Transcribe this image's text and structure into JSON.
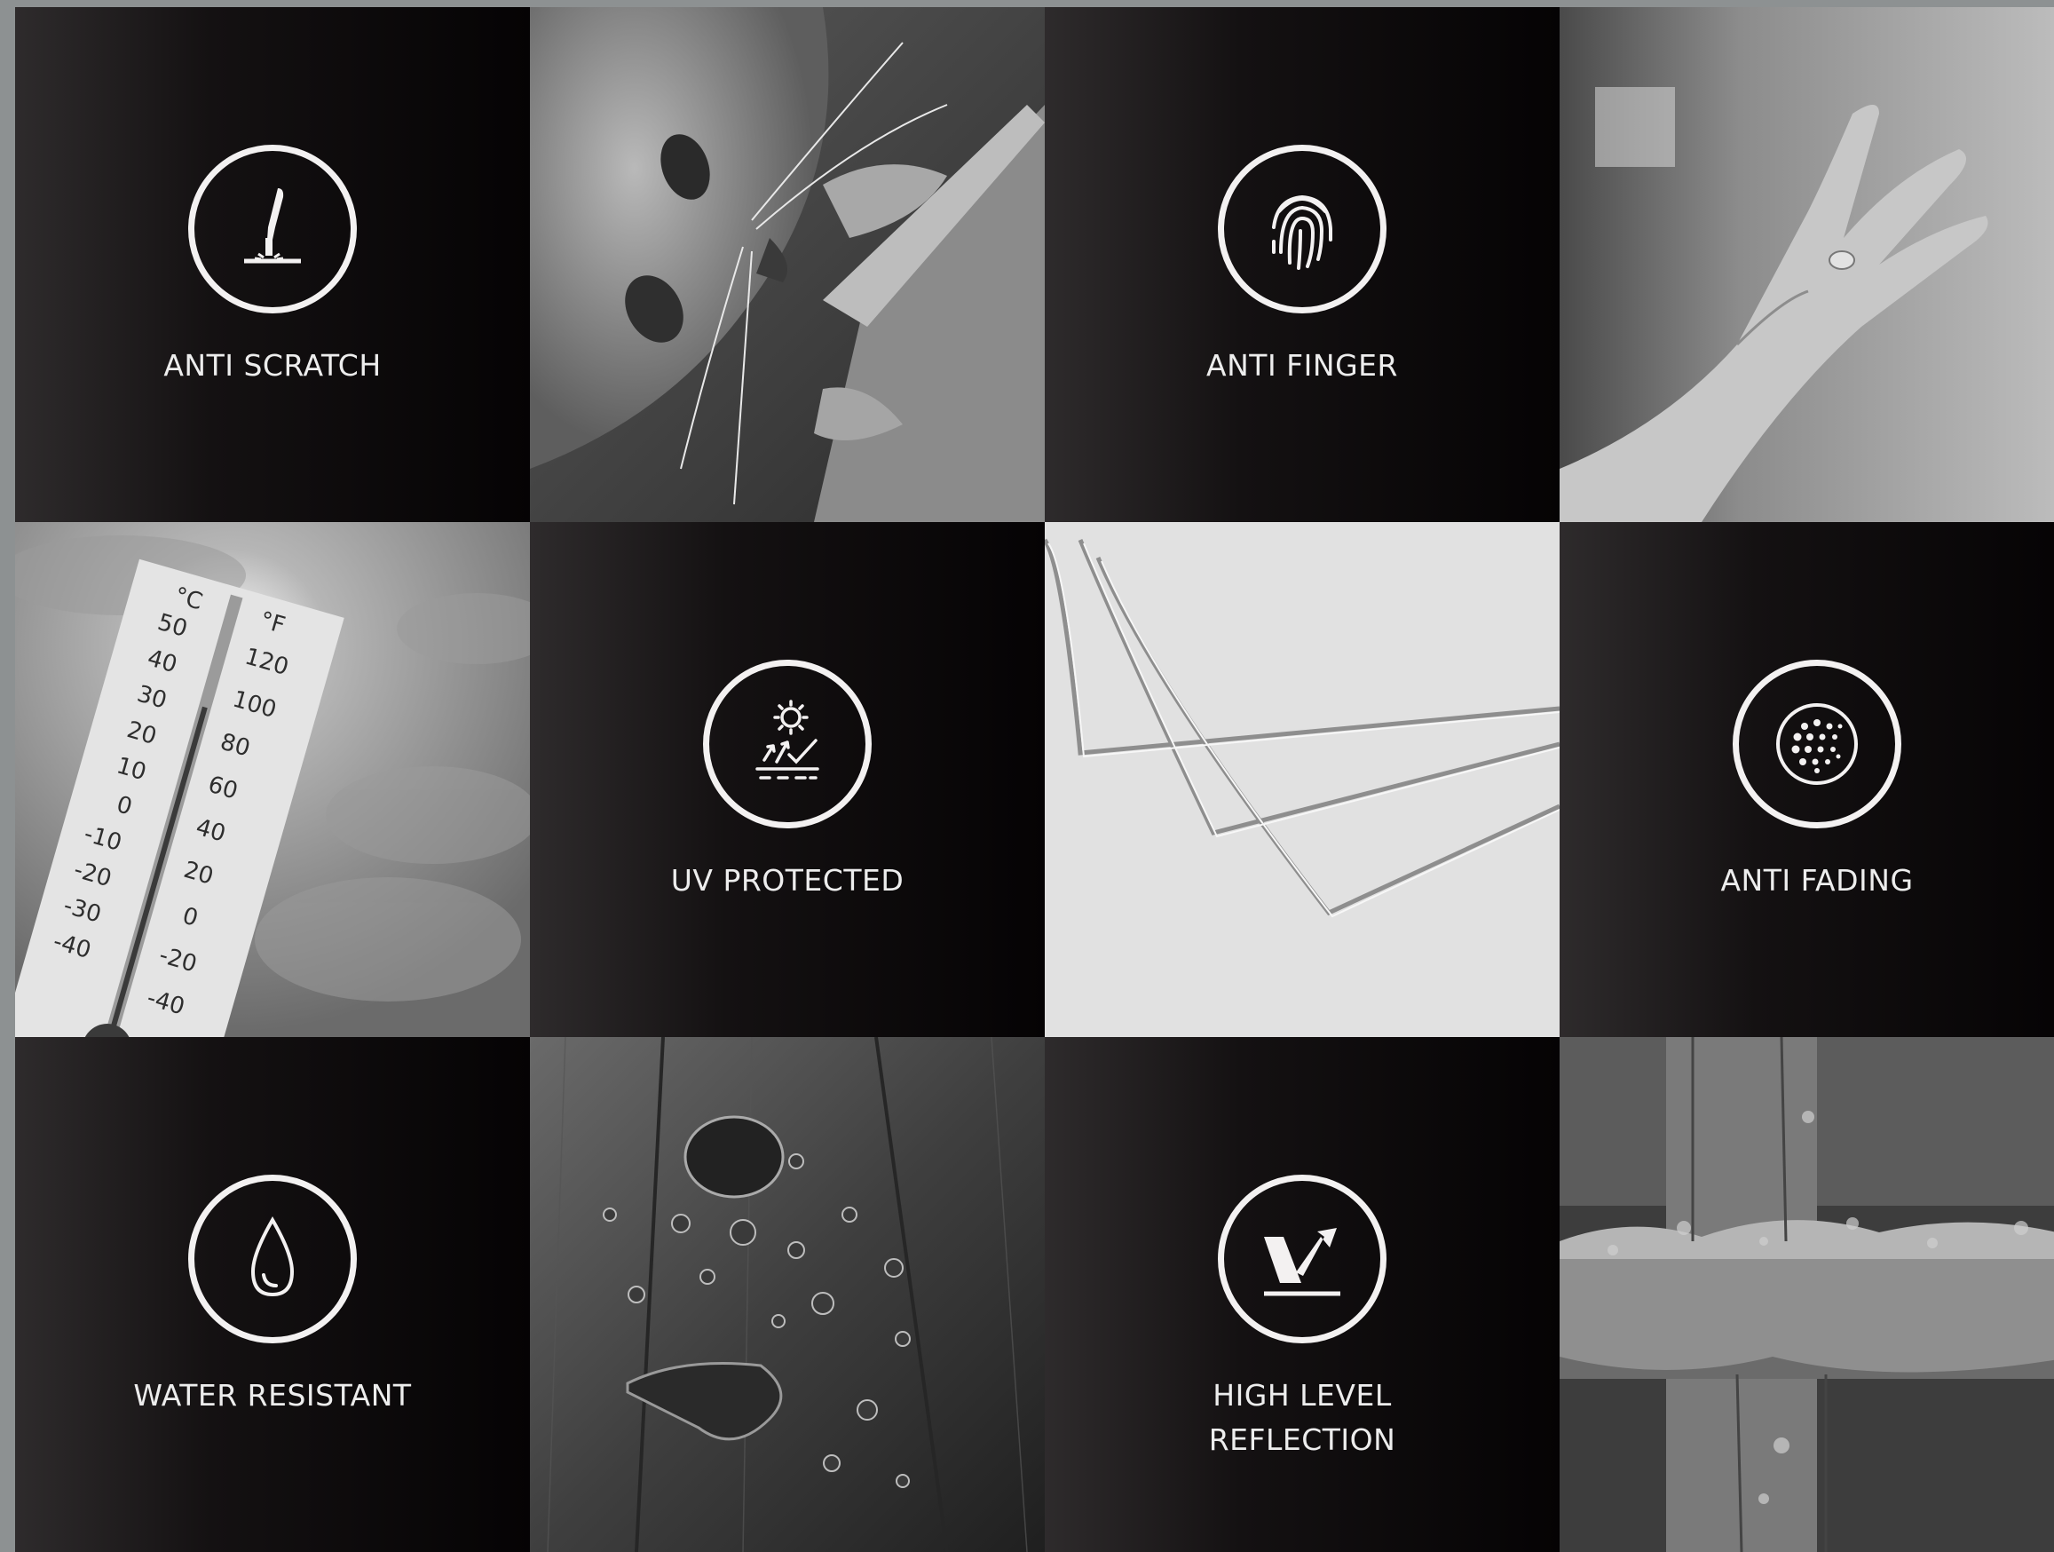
{
  "features": {
    "anti_scratch": {
      "label": "ANTI SCRATCH",
      "icon": "scratch-tool-icon"
    },
    "anti_finger": {
      "label": "ANTI FINGER",
      "icon": "fingerprint-icon"
    },
    "uv_protected": {
      "label": "UV PROTECTED",
      "icon": "uv-sun-icon"
    },
    "anti_fading": {
      "label": "ANTI FADING",
      "icon": "dotted-circle-icon"
    },
    "water_resistant": {
      "label": "WATER RESISTANT",
      "icon": "water-drop-icon"
    },
    "high_level_reflection": {
      "label": "HIGH  LEVEL\nREFLECTION",
      "icon": "reflection-check-icon"
    }
  },
  "thermometer": {
    "celsius_unit": "°C",
    "fahrenheit_unit": "°F",
    "celsius_scale": [
      "50",
      "40",
      "30",
      "20",
      "10",
      "0",
      "-10",
      "-20",
      "-30",
      "-40"
    ],
    "fahrenheit_scale": [
      "120",
      "100",
      "80",
      "60",
      "40",
      "20",
      "0",
      "-20",
      "-40"
    ]
  },
  "colors": {
    "icon_stroke": "#f3f1f1",
    "label_text": "#ededed",
    "tile_dark": "#050304",
    "background": "#8d9192"
  }
}
